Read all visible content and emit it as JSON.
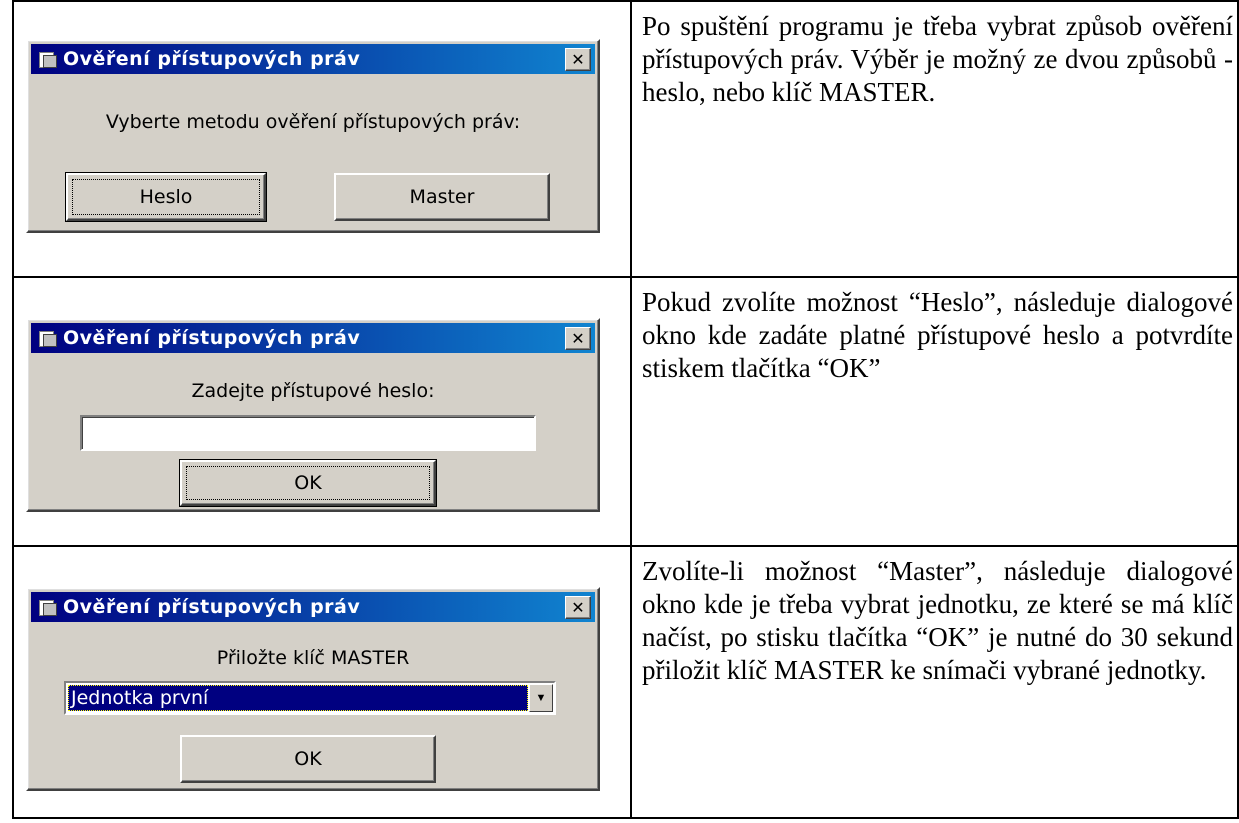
{
  "dialog_title": "Ověření přístupových práv",
  "close_glyph": "✕",
  "row1": {
    "prompt": "Vyberte metodu ověření přístupových práv:",
    "heslo_button": "Heslo",
    "master_button": "Master",
    "description": "Po spuštění programu je třeba vybrat způsob ověření přístupových práv. Výběr je možný ze dvou způsobů - heslo, nebo klíč MASTER."
  },
  "row2": {
    "prompt": "Zadejte přístupové heslo:",
    "password_value": "",
    "ok_button": "OK",
    "description": "Pokud zvolíte možnost “Heslo”, následuje dialogové okno kde zadáte platné přístupové heslo a potvrdíte stiskem tlačítka “OK”"
  },
  "row3": {
    "prompt": "Přiložte klíč MASTER",
    "unit_selected": "Jednotka první",
    "ok_button": "OK",
    "description": "Zvolíte-li možnost “Master”, následuje dialogové okno kde je třeba vybrat jednotku, ze které se má klíč načíst, po stisku tlačítka “OK” je nutné do 30 sekund přiložit klíč MASTER ke snímači vybrané jednotky."
  },
  "icons": {
    "title_icon": "window-app-icon",
    "close_icon": "close-icon",
    "dropdown_icon": "chevron-down-icon"
  },
  "colors": {
    "titlebar_start": "#000080",
    "titlebar_end": "#1084d0",
    "dialog_face": "#d4d0c8"
  }
}
